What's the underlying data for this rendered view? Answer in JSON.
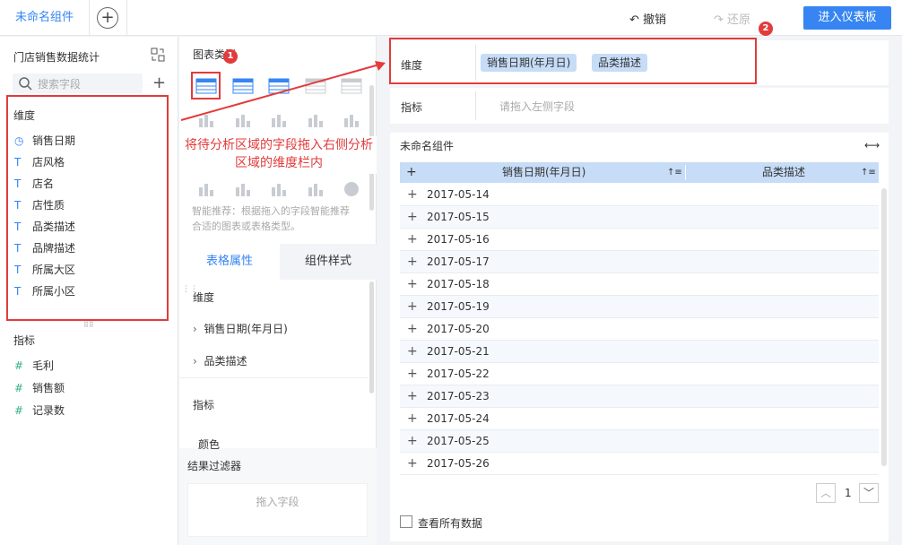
{
  "topbar": {
    "active_tab": "未命名组件",
    "add_tab": "+",
    "undo": "撤销",
    "redo": "还原",
    "enter_dashboard": "进入仪表板"
  },
  "left": {
    "dataset_title": "门店销售数据统计",
    "search_placeholder": "搜索字段",
    "dim_title": "维度",
    "dimensions": [
      {
        "icon": "clock-icon",
        "glyph": "◷",
        "label": "销售日期"
      },
      {
        "icon": "text-icon",
        "glyph": "T",
        "label": "店风格"
      },
      {
        "icon": "text-icon",
        "glyph": "T",
        "label": "店名"
      },
      {
        "icon": "text-icon",
        "glyph": "T",
        "label": "店性质"
      },
      {
        "icon": "text-icon",
        "glyph": "T",
        "label": "品类描述"
      },
      {
        "icon": "text-icon",
        "glyph": "T",
        "label": "品牌描述"
      },
      {
        "icon": "text-icon",
        "glyph": "T",
        "label": "所属大区"
      },
      {
        "icon": "text-icon",
        "glyph": "T",
        "label": "所属小区"
      }
    ],
    "ind_title": "指标",
    "indicators": [
      {
        "icon": "hash-icon",
        "glyph": "#",
        "label": "毛利"
      },
      {
        "icon": "hash-icon",
        "glyph": "#",
        "label": "销售额"
      },
      {
        "icon": "hash-count-icon",
        "glyph": "#",
        "label": "记录数"
      }
    ]
  },
  "middle": {
    "chart_type_title": "图表类型",
    "smart_tip": "智能推荐：根据拖入的字段智能推荐合适的图表或表格类型。",
    "tab_table_prop": "表格属性",
    "tab_comp_style": "组件样式",
    "dim_section": "维度",
    "dim_items": [
      "销售日期(年月日)",
      "品类描述"
    ],
    "ind_section": "指标",
    "color_section": "颜色",
    "result_filter": "结果过滤器",
    "drop_field": "拖入字段"
  },
  "right": {
    "dim_label": "维度",
    "dim_pills": [
      "销售日期(年月日)",
      "品类描述"
    ],
    "ind_label": "指标",
    "ind_placeholder": "请拖入左侧字段",
    "widget_title": "未命名组件",
    "columns": [
      "销售日期(年月日)",
      "品类描述"
    ],
    "rows": [
      "2017-05-14",
      "2017-05-15",
      "2017-05-16",
      "2017-05-17",
      "2017-05-18",
      "2017-05-19",
      "2017-05-20",
      "2017-05-21",
      "2017-05-22",
      "2017-05-23",
      "2017-05-24",
      "2017-05-25",
      "2017-05-26"
    ],
    "page": "1",
    "view_all": "查看所有数据"
  },
  "annotation": {
    "text": "将待分析区域的字段拖入右侧分析区域的维度栏内",
    "badge1": "1",
    "badge2": "2",
    "color": "#e23b3b"
  }
}
